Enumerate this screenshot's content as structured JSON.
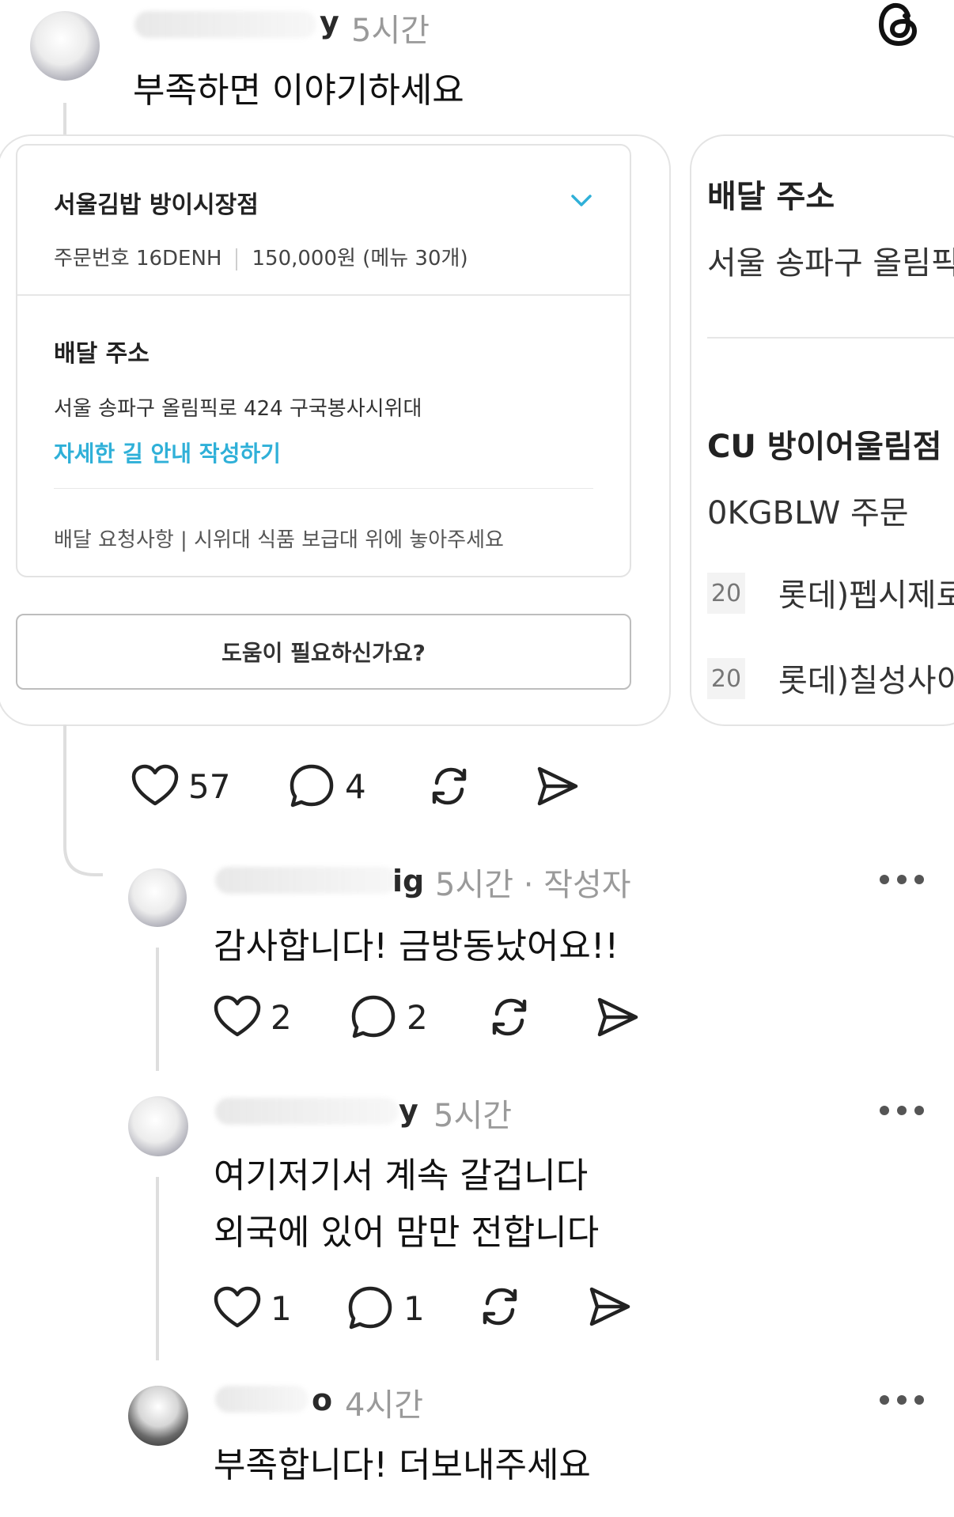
{
  "post": {
    "handle_tail": "y",
    "time": "5시간",
    "text": "부족하면 이야기하세요",
    "order_card": {
      "store": "서울김밥 방이시장점",
      "order_no": "주문번호 16DENH",
      "amount": "150,000원 (메뉴 30개)",
      "address_title": "배달 주소",
      "address": "서울 송파구 올림픽로 424 구국봉사시위대",
      "guide_link": "자세한 길 안내 작성하기",
      "request": "배달 요청사항 | 시위대 식품 보급대 위에 놓아주세요",
      "help": "도움이 필요하신가요?"
    },
    "second_card": {
      "address_title": "배달 주소",
      "address": "서울 송파구 올림픽...",
      "store": "CU 방이어울림점",
      "order": "0KGBLW 주문",
      "items": [
        {
          "qty": "20",
          "name": "롯데)펩시제로"
        },
        {
          "qty": "20",
          "name": "롯데)칠성사이"
        }
      ]
    },
    "likes": "57",
    "replies": "4"
  },
  "comments": [
    {
      "handle_tail": "ig",
      "time": "5시간 · 작성자",
      "lines": [
        "감사합니다! 금방동났어요!!"
      ],
      "likes": "2",
      "replies": "2"
    },
    {
      "handle_tail": "y",
      "time": "5시간",
      "lines": [
        "여기저기서 계속 갈겁니다",
        "외국에 있어 맘만 전합니다"
      ],
      "likes": "1",
      "replies": "1"
    },
    {
      "handle_tail": "o",
      "time": "4시간",
      "lines": [
        "부족합니다! 더보내주세요"
      ]
    }
  ],
  "icons": {
    "app": "threads-logo-icon",
    "like": "heart-icon",
    "reply": "comment-icon",
    "repost": "repost-icon",
    "share": "send-icon",
    "more": "more-icon"
  },
  "colors": {
    "link": "#2fb0d8",
    "muted": "#9a9a9a"
  }
}
